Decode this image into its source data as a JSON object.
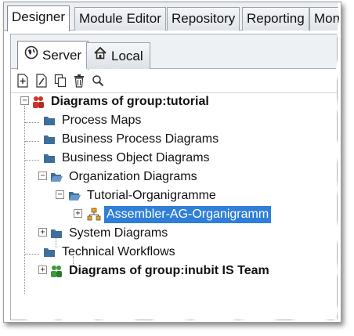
{
  "top_tabs": [
    {
      "label": "Designer",
      "active": true
    },
    {
      "label": "Module Editor",
      "active": false
    },
    {
      "label": "Repository",
      "active": false
    },
    {
      "label": "Reporting",
      "active": false
    },
    {
      "label": "Mon",
      "active": false
    }
  ],
  "sub_tabs": [
    {
      "label": "Server",
      "icon": "globe-icon",
      "active": true
    },
    {
      "label": "Local",
      "icon": "house-icon",
      "active": false
    }
  ],
  "toolbar": {
    "icons": [
      "new-diagram-icon",
      "edit-icon",
      "copy-icon",
      "delete-icon",
      "search-icon"
    ]
  },
  "tree": {
    "root": {
      "label": "Diagrams of group:tutorial",
      "bold": true,
      "expanded": true,
      "icon": "group-icon"
    },
    "items": [
      {
        "label": "Process Maps",
        "icon": "folder-icon"
      },
      {
        "label": "Business Process Diagrams",
        "icon": "folder-icon"
      },
      {
        "label": "Business Object Diagrams",
        "icon": "folder-icon"
      },
      {
        "label": "Organization Diagrams",
        "icon": "open-folder-icon",
        "expanded": true
      },
      {
        "label": "Tutorial-Organigramme",
        "icon": "open-folder-icon",
        "expanded": true
      },
      {
        "label": "Assembler-AG-Organigramm",
        "icon": "org-chart-icon",
        "selected": true
      },
      {
        "label": "System Diagrams",
        "icon": "folder-icon",
        "expanded": false
      },
      {
        "label": "Technical Workflows",
        "icon": "folder-icon"
      },
      {
        "label": "Diagrams of group:inubit IS Team",
        "icon": "group-icon",
        "bold": true,
        "expanded": false
      }
    ]
  },
  "colors": {
    "selection": "#2f7fd8",
    "folder": "#3f6e9c",
    "group_red": "#d0342c",
    "group_green": "#3c9a3c"
  }
}
